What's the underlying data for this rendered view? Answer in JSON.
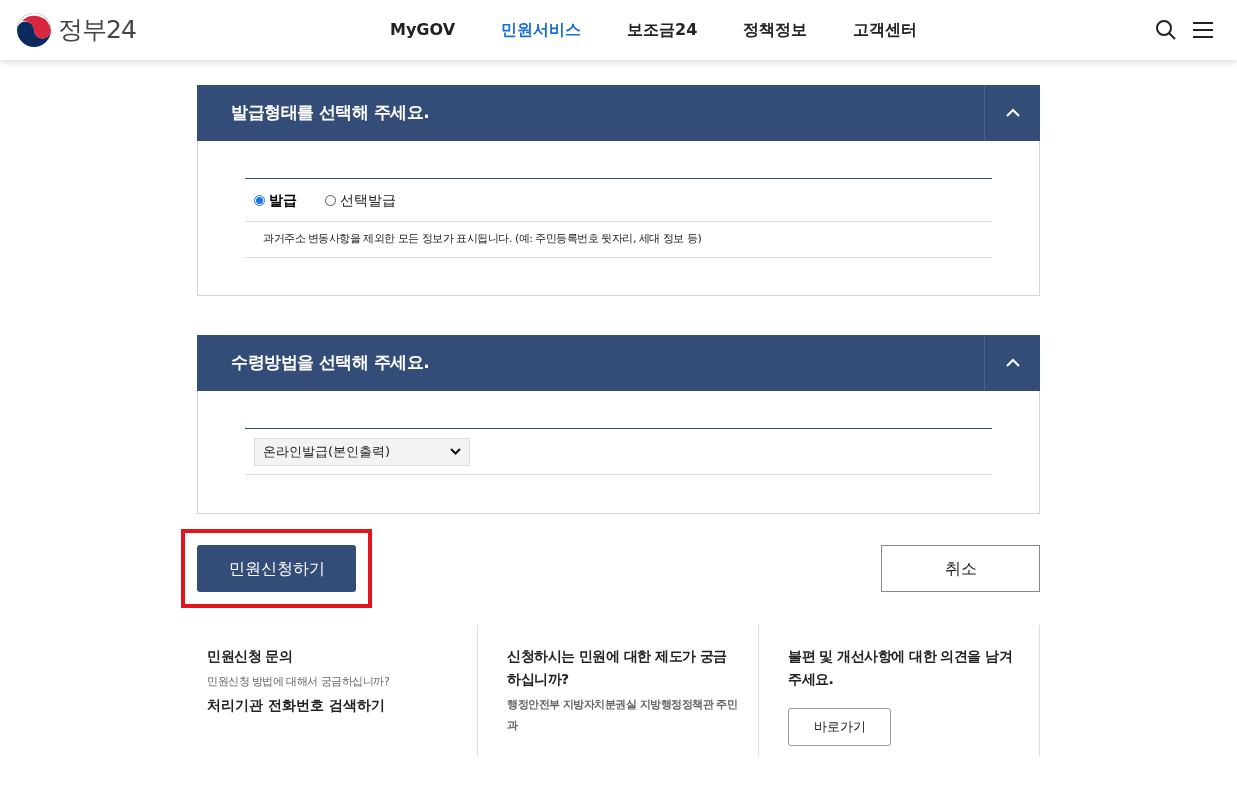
{
  "header": {
    "logo_text": "정부24",
    "nav": [
      {
        "label": "MyGOV",
        "selected": false
      },
      {
        "label": "민원서비스",
        "selected": true
      },
      {
        "label": "보조금24",
        "selected": false
      },
      {
        "label": "정책정보",
        "selected": false
      },
      {
        "label": "고객센터",
        "selected": false
      }
    ]
  },
  "sections": [
    {
      "title": "발급형태를 선택해 주세요.",
      "expanded": true,
      "kind": "radio",
      "options": [
        {
          "label": "발급",
          "selected": true
        },
        {
          "label": "선택발급",
          "selected": false
        }
      ],
      "note": "과거주소 변동사항을 제외한 모든 정보가 표시됩니다. (예: 주민등록번호 뒷자리, 세대 정보 등)"
    },
    {
      "title": "수령방법을 선택해 주세요.",
      "expanded": true,
      "kind": "select",
      "value": "온라인발급(본인출력)"
    }
  ],
  "actions": {
    "submit": "민원신청하기",
    "submit_highlighted": true,
    "cancel": "취소"
  },
  "footer": [
    {
      "title": "민원신청 문의",
      "subtitle": "민원신청 방법에 대해서 궁금하십니까?",
      "link": "처리기관 전화번호 검색하기"
    },
    {
      "title": "신청하시는 민원에 대한 제도가 궁금하십니까?",
      "subtitle": "행정안전부 지방자치분권실 지방행정정책관 주민과"
    },
    {
      "title": "불편 및 개선사항에 대한 의견을 남겨주세요.",
      "button": "바로가기"
    }
  ]
}
